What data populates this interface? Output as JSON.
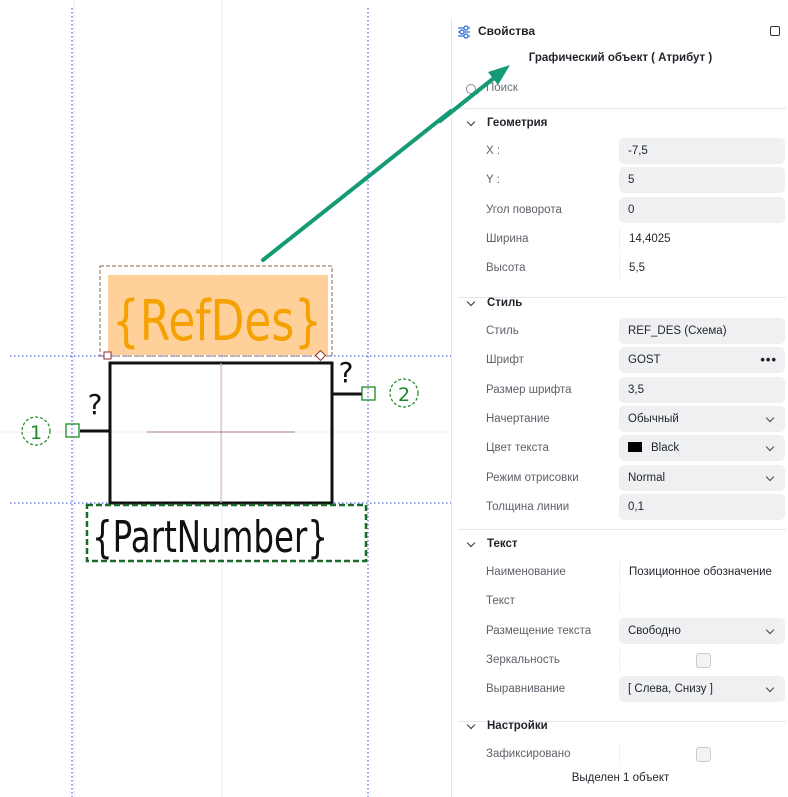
{
  "canvas": {
    "refdes_text": "{RefDes}",
    "partnumber_text": "{PartNumber}",
    "pin_left_number": "1",
    "pin_right_number": "2",
    "pin_left_name": "?",
    "pin_right_name": "?",
    "refdes_fill": "#ffd09a",
    "refdes_text_color": "#f5a100",
    "partnumber_border_color": "#1a6b2a",
    "arrow_color": "#149b75"
  },
  "panel": {
    "header_title": "Свойства",
    "object_title": "Графический объект ( Атрибут )",
    "search_placeholder": "Поиск",
    "footer": "Выделен 1 объект",
    "sections": {
      "geometry": {
        "title": "Геометрия",
        "rows": [
          {
            "label": "X :",
            "value": "-7,5"
          },
          {
            "label": "Y :",
            "value": "5"
          },
          {
            "label": "Угол поворота",
            "value": "0"
          },
          {
            "label": "Ширина",
            "value": "14,4025"
          },
          {
            "label": "Высота",
            "value": "5,5"
          }
        ]
      },
      "style": {
        "title": "Стиль",
        "rows": [
          {
            "label": "Стиль",
            "value": "REF_DES (Схема)"
          },
          {
            "label": "Шрифт",
            "value": "GOST"
          },
          {
            "label": "Размер шрифта",
            "value": "3,5"
          },
          {
            "label": "Начертание",
            "value": "Обычный"
          },
          {
            "label": "Цвет текста",
            "value": "Black",
            "color": "#000000"
          },
          {
            "label": "Режим отрисовки",
            "value": "Normal"
          },
          {
            "label": "Толщина линии",
            "value": "0,1"
          }
        ]
      },
      "text": {
        "title": "Текст",
        "rows": [
          {
            "label": "Наименование",
            "value": "Позиционное обозначение"
          },
          {
            "label": "Текст",
            "value": ""
          },
          {
            "label": "Размещение текста",
            "value": "Свободно"
          },
          {
            "label": "Зеркальность",
            "checked": false
          },
          {
            "label": "Выравнивание",
            "value": "[ Слева, Снизу ]"
          }
        ]
      },
      "settings": {
        "title": "Настройки",
        "rows": [
          {
            "label": "Зафиксировано",
            "checked": false
          }
        ]
      }
    }
  }
}
